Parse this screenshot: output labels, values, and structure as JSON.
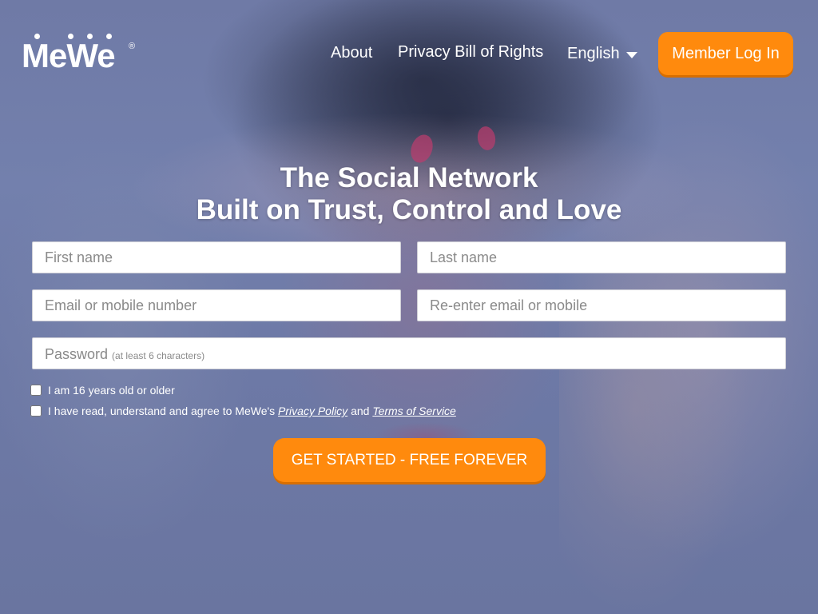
{
  "brand": {
    "name": "MeWe",
    "registered_mark": "®"
  },
  "nav": {
    "about": "About",
    "privacy_bill": "Privacy Bill of Rights",
    "language": "English",
    "login": "Member Log In"
  },
  "hero": {
    "line1": "The Social Network",
    "line2": "Built on Trust, Control and Love"
  },
  "form": {
    "first_name_placeholder": "First name",
    "last_name_placeholder": "Last name",
    "email_placeholder": "Email or mobile number",
    "email_confirm_placeholder": "Re-enter email or mobile",
    "password_placeholder": "Password",
    "password_hint": "(at least 6 characters)",
    "age_checkbox_label": "I am 16 years old or older",
    "terms_prefix": "I have read, understand and agree to MeWe's",
    "privacy_policy_link": "Privacy Policy",
    "terms_and": "and",
    "terms_of_service_link": "Terms of Service",
    "submit": "GET STARTED - FREE FOREVER"
  },
  "colors": {
    "accent": "#ff8a0d",
    "overlay": "#6f7aa6",
    "text": "#ffffff"
  }
}
